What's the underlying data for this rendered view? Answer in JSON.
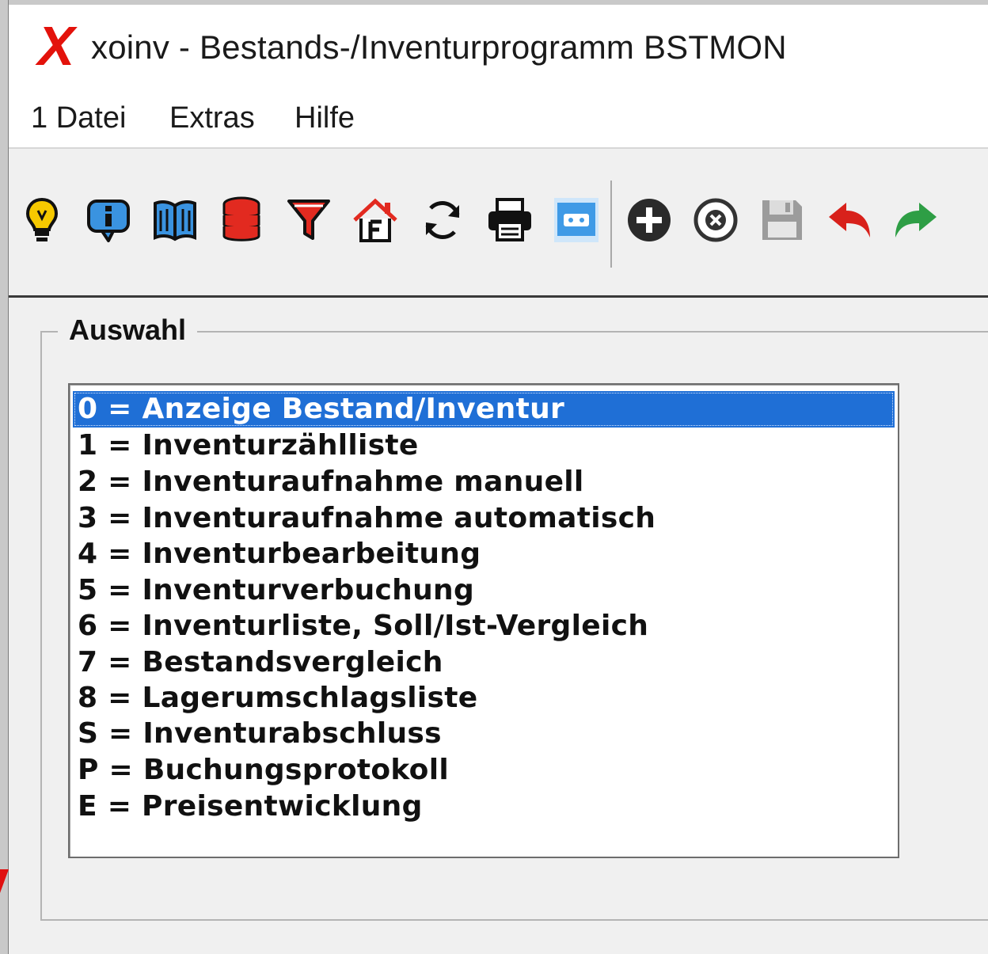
{
  "window": {
    "logo_text": "X",
    "title": "xoinv - Bestands-/Inventurprogramm BSTMON"
  },
  "menu": {
    "items": [
      "1 Datei",
      "Extras",
      "Hilfe"
    ]
  },
  "toolbar": {
    "icons": [
      {
        "name": "lightbulb-icon",
        "color": "#f2c200"
      },
      {
        "name": "info-icon",
        "color": "#2b7fd6"
      },
      {
        "name": "book-icon",
        "color": "#2b7fd6"
      },
      {
        "name": "database-icon",
        "color": "#d8211b"
      },
      {
        "name": "filter-icon",
        "color": "#d8211b"
      },
      {
        "name": "home-f-icon",
        "color": "#d8211b"
      },
      {
        "name": "refresh-icon",
        "color": "#111111"
      },
      {
        "name": "printer-icon",
        "color": "#111111"
      },
      {
        "name": "window-icon",
        "color": "#3f9ae6"
      },
      {
        "name": "add-circle-icon",
        "color": "#222222"
      },
      {
        "name": "cancel-circle-icon",
        "color": "#333333"
      },
      {
        "name": "save-icon",
        "color": "#9a9a9a"
      },
      {
        "name": "undo-icon",
        "color": "#d8211b"
      },
      {
        "name": "redo-icon",
        "color": "#2e9e45"
      }
    ]
  },
  "selection": {
    "label": "Auswahl",
    "selected_index": 0,
    "items": [
      "0 = Anzeige Bestand/Inventur",
      "1 = Inventurzählliste",
      "2 = Inventuraufnahme manuell",
      "3 = Inventuraufnahme automatisch",
      "4 = Inventurbearbeitung",
      "5 = Inventurverbuchung",
      "6 = Inventurliste, Soll/Ist-Vergleich",
      "7 = Bestandsvergleich",
      "8 = Lagerumschlagsliste",
      "S = Inventurabschluss",
      "P = Buchungsprotokoll",
      "E = Preisentwicklung"
    ]
  },
  "colors": {
    "selection_bg": "#1f6fd6",
    "logo_red": "#e3120b"
  }
}
